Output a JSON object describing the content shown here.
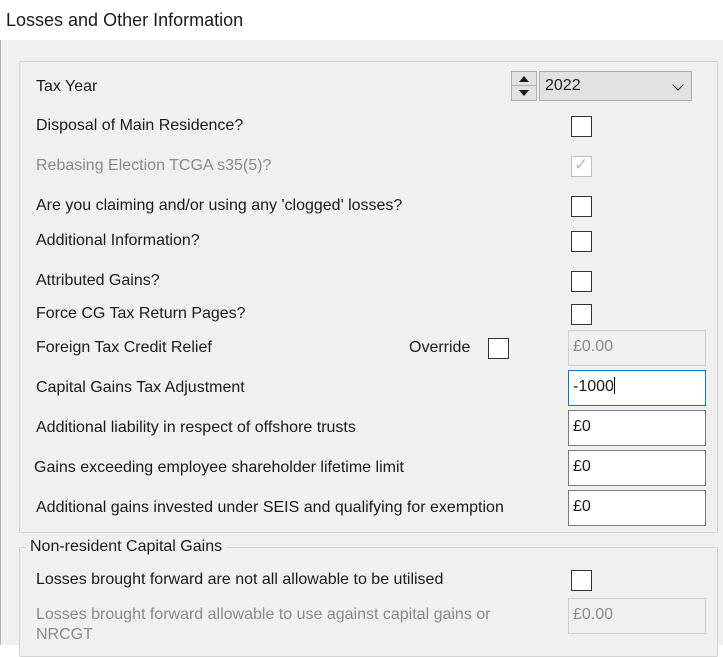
{
  "window": {
    "title": "Losses and Other Information"
  },
  "tax_year": {
    "label": "Tax Year",
    "value": "2022"
  },
  "rows": {
    "disposal_main_residence": {
      "label": "Disposal of Main Residence?",
      "checked": false
    },
    "rebasing_election": {
      "label": "Rebasing Election TCGA s35(5)?",
      "checked": true,
      "disabled": true
    },
    "clogged_losses": {
      "label": "Are you claiming and/or using any 'clogged' losses?",
      "checked": false
    },
    "additional_information": {
      "label": "Additional Information?",
      "checked": false
    },
    "attributed_gains": {
      "label": "Attributed Gains?",
      "checked": false
    },
    "force_cg_pages": {
      "label": "Force CG Tax Return Pages?",
      "checked": false
    }
  },
  "foreign_tax": {
    "label": "Foreign Tax Credit Relief",
    "override_label": "Override",
    "value": "£0.00"
  },
  "cgt_adjustment": {
    "label": "Capital Gains Tax Adjustment",
    "value": "-1000"
  },
  "offshore_trusts": {
    "label": "Additional liability in respect of offshore trusts",
    "value": "£0"
  },
  "employee_shareholder": {
    "label": "Gains exceeding employee shareholder lifetime limit",
    "value": "£0"
  },
  "seis_gains": {
    "label": "Additional gains invested under SEIS and qualifying for exemption",
    "value": "£0"
  },
  "nrcg": {
    "group_title": "Non-resident Capital Gains",
    "losses_not_allowable": {
      "label": "Losses brought forward are not all allowable to be utilised",
      "checked": false
    },
    "losses_allowable": {
      "label_line1": "Losses brought forward allowable to use against capital gains or",
      "label_line2": "NRCGT",
      "value": "£0.00"
    }
  },
  "icons": {
    "check": "checkmark-icon",
    "spin_up": "arrow-up-icon",
    "spin_down": "arrow-down-icon",
    "dropdown": "chevron-down-icon"
  },
  "colors": {
    "focus_border": "#0078d7",
    "dialog_bg": "#f0f0f0",
    "disabled_text": "#8a8a8a"
  }
}
